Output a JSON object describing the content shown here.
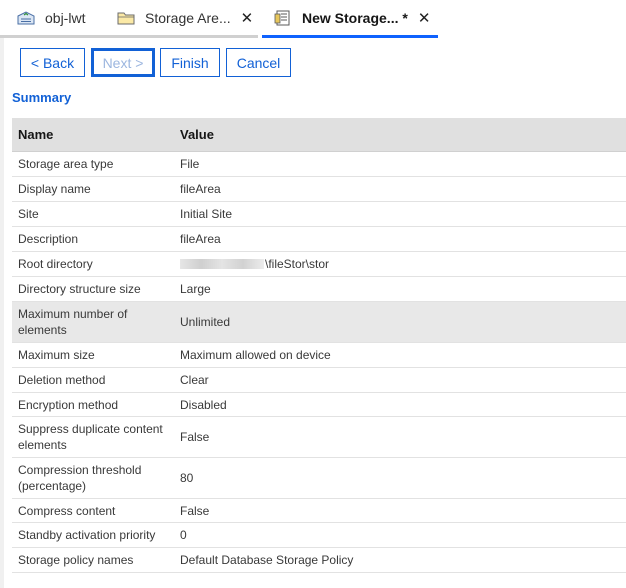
{
  "tabs": [
    {
      "label": "obj-lwt",
      "icon": "object-store-icon",
      "active": false
    },
    {
      "label": "Storage Are...",
      "icon": "folder-icon",
      "active": false
    },
    {
      "label": "New Storage... *",
      "icon": "document-icon",
      "active": true
    }
  ],
  "buttons": {
    "back": "< Back",
    "next": "Next >",
    "finish": "Finish",
    "cancel": "Cancel"
  },
  "summary_title": "Summary",
  "table": {
    "headers": {
      "name": "Name",
      "value": "Value"
    },
    "rows": [
      {
        "name": "Storage area type",
        "value": "File"
      },
      {
        "name": "Display name",
        "value": "fileArea"
      },
      {
        "name": "Site",
        "value": "Initial Site"
      },
      {
        "name": "Description",
        "value": "fileArea"
      },
      {
        "name": "Root directory",
        "value": "\\fileStor\\stor"
      },
      {
        "name": "Directory structure size",
        "value": "Large"
      },
      {
        "name": "Maximum number of elements",
        "value": "Unlimited"
      },
      {
        "name": "Maximum size",
        "value": "Maximum allowed on device"
      },
      {
        "name": "Deletion method",
        "value": "Clear"
      },
      {
        "name": "Encryption method",
        "value": "Disabled"
      },
      {
        "name": "Suppress duplicate content elements",
        "value": "False"
      },
      {
        "name": "Compression threshold (percentage)",
        "value": "80"
      },
      {
        "name": "Compress content",
        "value": "False"
      },
      {
        "name": "Standby activation priority",
        "value": "0"
      },
      {
        "name": "Storage policy names",
        "value": "Default Database Storage Policy"
      }
    ]
  },
  "colors": {
    "accent": "#1261d6",
    "active_tab": "#0f62fe",
    "header_bg": "#e0e0e0",
    "highlight_row": "#e8e8e8"
  }
}
